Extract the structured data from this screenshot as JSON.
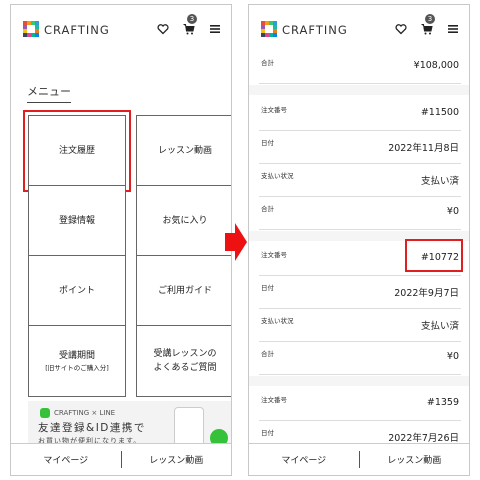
{
  "brand": {
    "name": "CRAFTING"
  },
  "header": {
    "cart_count": "3"
  },
  "menu": {
    "title": "メニュー",
    "items": [
      {
        "label": "注文履歴"
      },
      {
        "label": "レッスン動画"
      },
      {
        "label": "登録情報"
      },
      {
        "label": "お気に入り"
      },
      {
        "label": "ポイント"
      },
      {
        "label": "ご利用ガイド"
      },
      {
        "label": "受講期間",
        "sub": "[旧サイトのご購入分]"
      },
      {
        "label": "受講レッスンの",
        "label2": "よくあるご質問"
      }
    ],
    "highlighted": "注文履歴"
  },
  "banner": {
    "brand": "CRAFTING × LINE",
    "title": "友達登録&ID連携で",
    "subtitle": "お買い物が便利になります。"
  },
  "bottom_nav": {
    "left": "マイページ",
    "right": "レッスン動画"
  },
  "orders": {
    "row0": {
      "label": "合計",
      "value": "¥108,000"
    },
    "row1": {
      "label": "注文番号",
      "value": "#11500"
    },
    "row2": {
      "label": "日付",
      "value": "2022年11月8日"
    },
    "row3": {
      "label": "支払い状況",
      "value": "支払い済"
    },
    "row4": {
      "label": "合計",
      "value": "¥0"
    },
    "row5": {
      "label": "注文番号",
      "value": "#10772"
    },
    "row6": {
      "label": "日付",
      "value": "2022年9月7日"
    },
    "row7": {
      "label": "支払い状況",
      "value": "支払い済"
    },
    "row8": {
      "label": "合計",
      "value": "¥0"
    },
    "row9": {
      "label": "注文番号",
      "value": "#1359"
    },
    "row10": {
      "label": "日付",
      "value": "2022年7月26日"
    },
    "highlighted": "#10772"
  },
  "colors": {
    "highlight": "#e02020",
    "arrow": "#ee1111",
    "line": "#35c23a"
  },
  "icons": [
    "heart-icon",
    "cart-icon",
    "hamburger-icon",
    "right-arrow-icon"
  ]
}
